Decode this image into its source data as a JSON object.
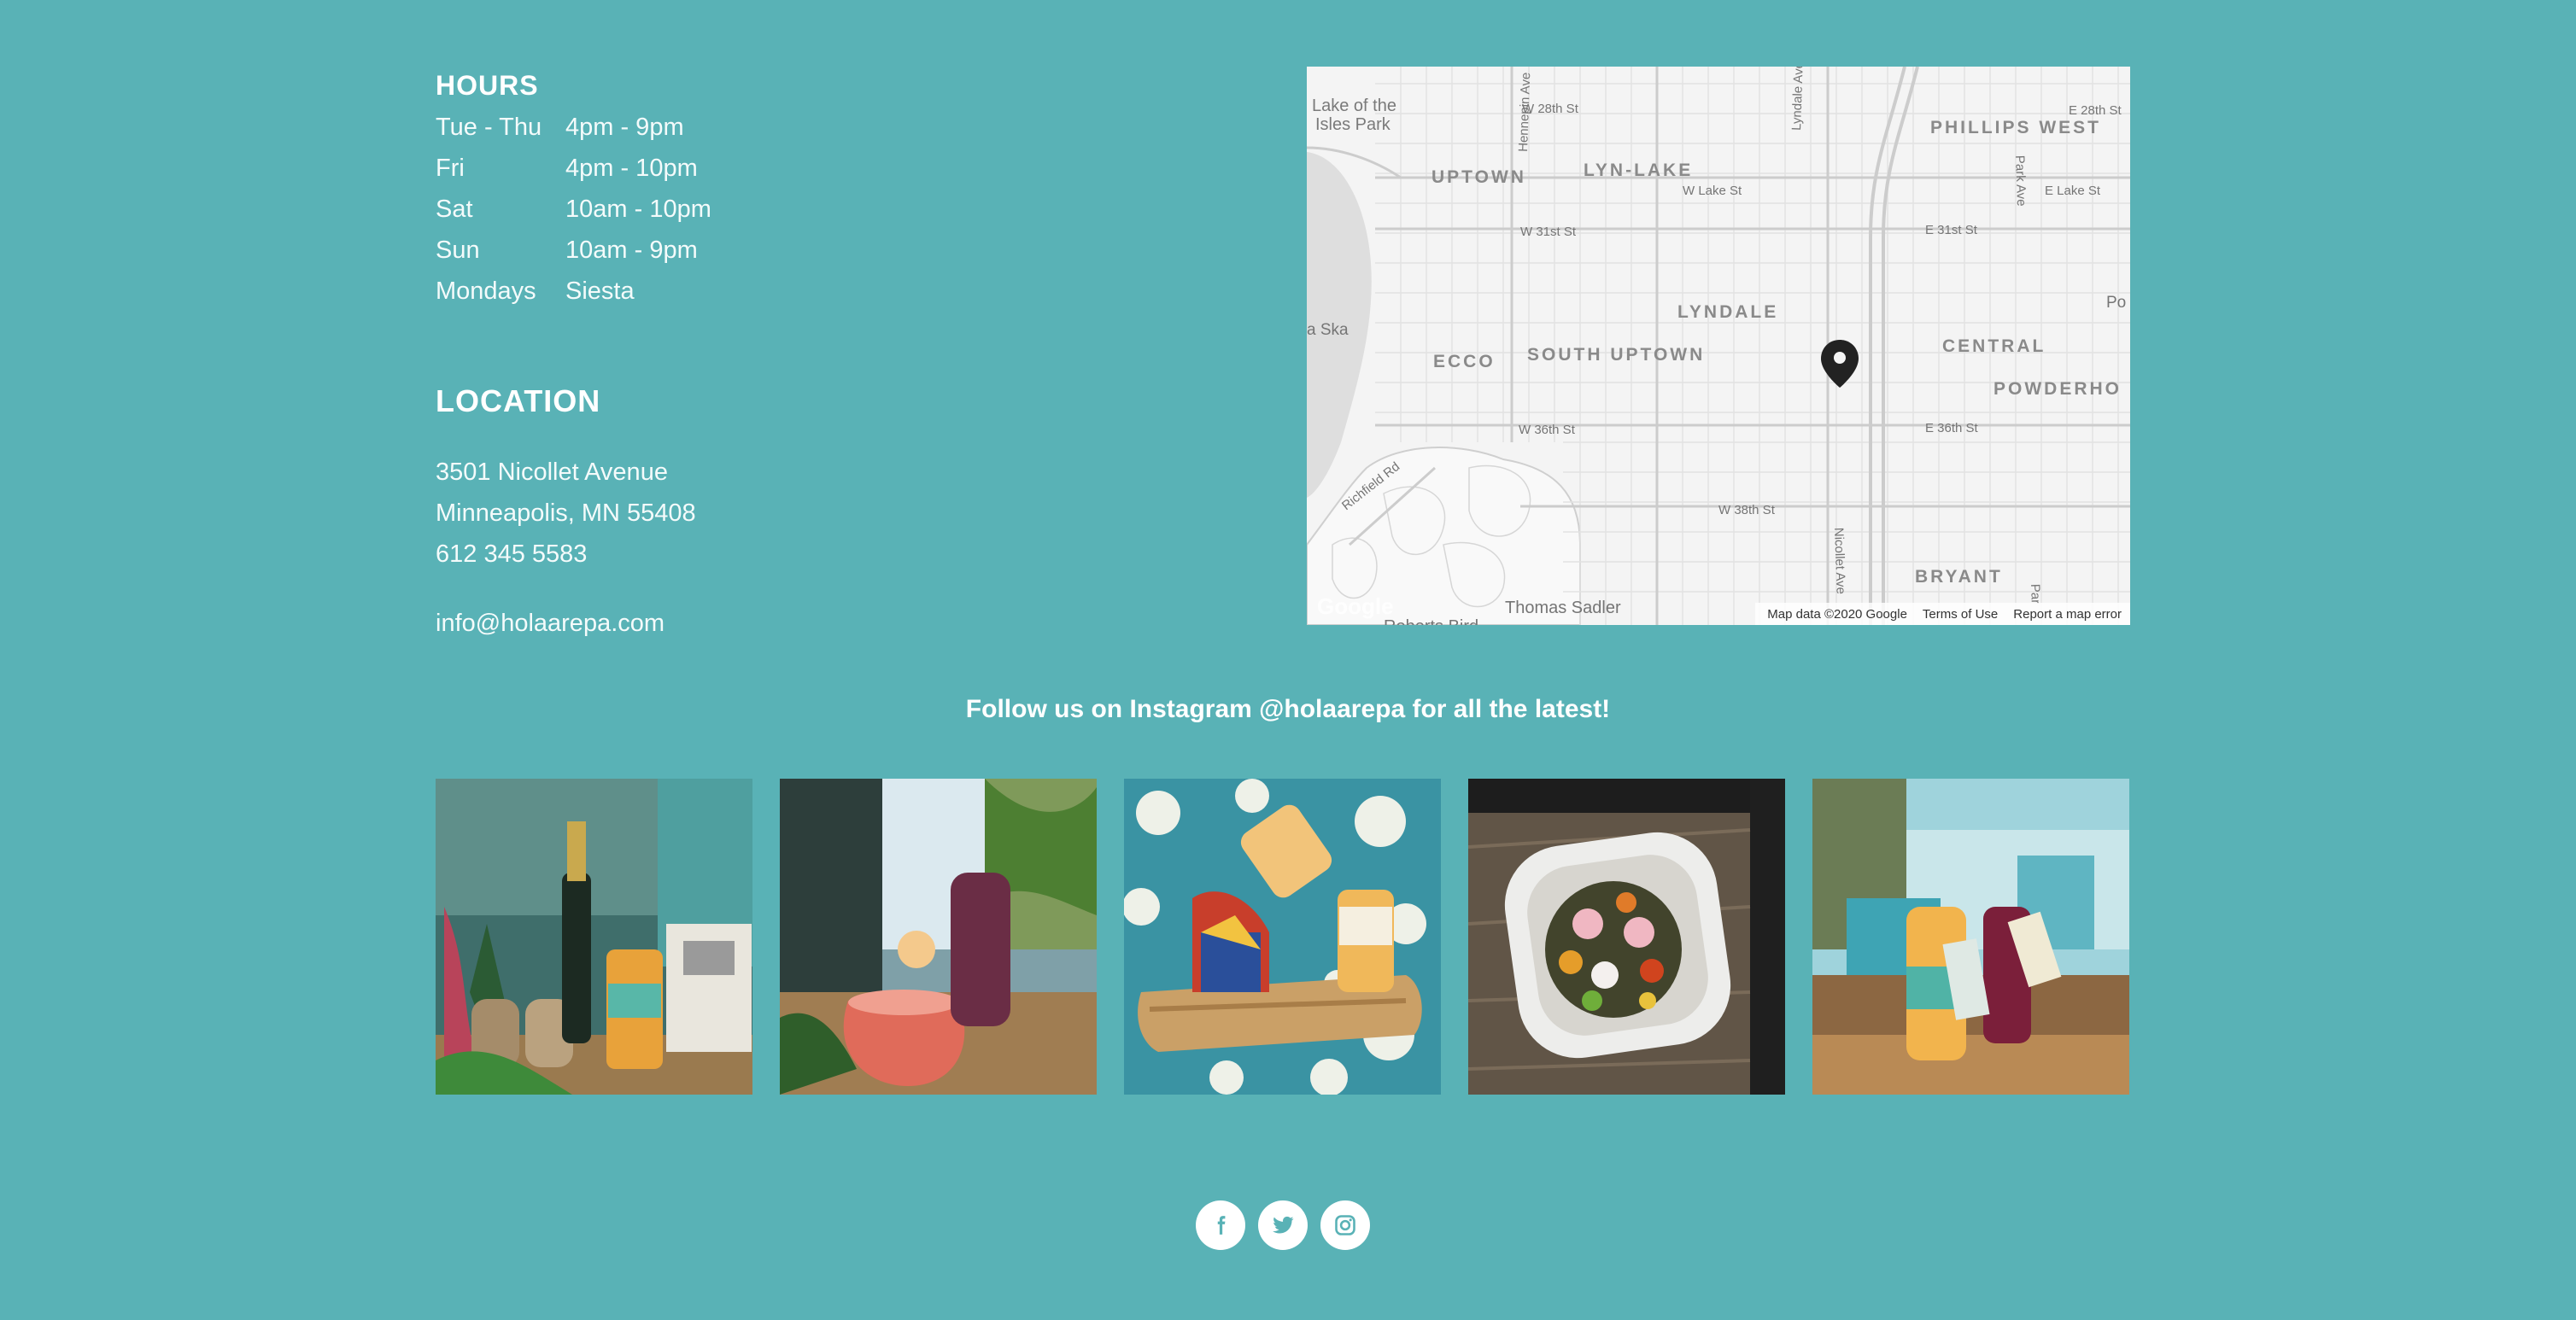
{
  "hours": {
    "heading": "HOURS",
    "rows": [
      {
        "day": "Tue - Thu",
        "time": "4pm - 9pm"
      },
      {
        "day": "Fri",
        "time": "4pm - 10pm"
      },
      {
        "day": "Sat",
        "time": "10am - 10pm"
      },
      {
        "day": "Sun",
        "time": "10am - 9pm"
      },
      {
        "day": "Mondays",
        "time": "Siesta"
      }
    ]
  },
  "location": {
    "heading": "LOCATION",
    "street": "3501 Nicollet Avenue",
    "city": "Minneapolis, MN 55408",
    "phone": "612 345 5583",
    "email": "info@holaarepa.com"
  },
  "map": {
    "labels": {
      "lake": "Lake of the Isles Park",
      "uptown": "UPTOWN",
      "lyn_lake": "LYN-LAKE",
      "phillips_west": "PHILLIPS WEST",
      "lyndale": "LYNDALE",
      "ecco": "ECCO",
      "south_uptown": "SOUTH UPTOWN",
      "central": "CENTRAL",
      "powderhorn": "POWDERHO",
      "bryant": "BRYANT",
      "w28": "W 28th St",
      "e28": "E 28th St",
      "w_lake": "W Lake St",
      "e_lake": "E Lake St",
      "w31": "W 31st St",
      "e31": "E 31st St",
      "w36": "W 36th St",
      "e36": "E 36th St",
      "w38": "W 38th St",
      "hennepin": "Hennepin Ave",
      "lyndale_ave": "Lyndale Ave",
      "nicollet": "Nicollet Ave",
      "park_ave": "Park Ave",
      "richfield": "Richfield Rd",
      "ska": "a Ska",
      "thomas": "Thomas Sadler",
      "roberts": "Roberts Bird",
      "po": "Po",
      "par": "Par"
    },
    "google": "Google",
    "attribution": "Map data ©2020 Google",
    "terms": "Terms of Use",
    "report": "Report a map error"
  },
  "instagram": {
    "heading": "Follow us on Instagram @holaarepa for all the latest!"
  },
  "social": [
    "facebook-icon",
    "twitter-icon",
    "instagram-icon"
  ],
  "colors": {
    "background": "#59b2b6",
    "map_background": "#f4f4f4",
    "marker": "#222222"
  }
}
